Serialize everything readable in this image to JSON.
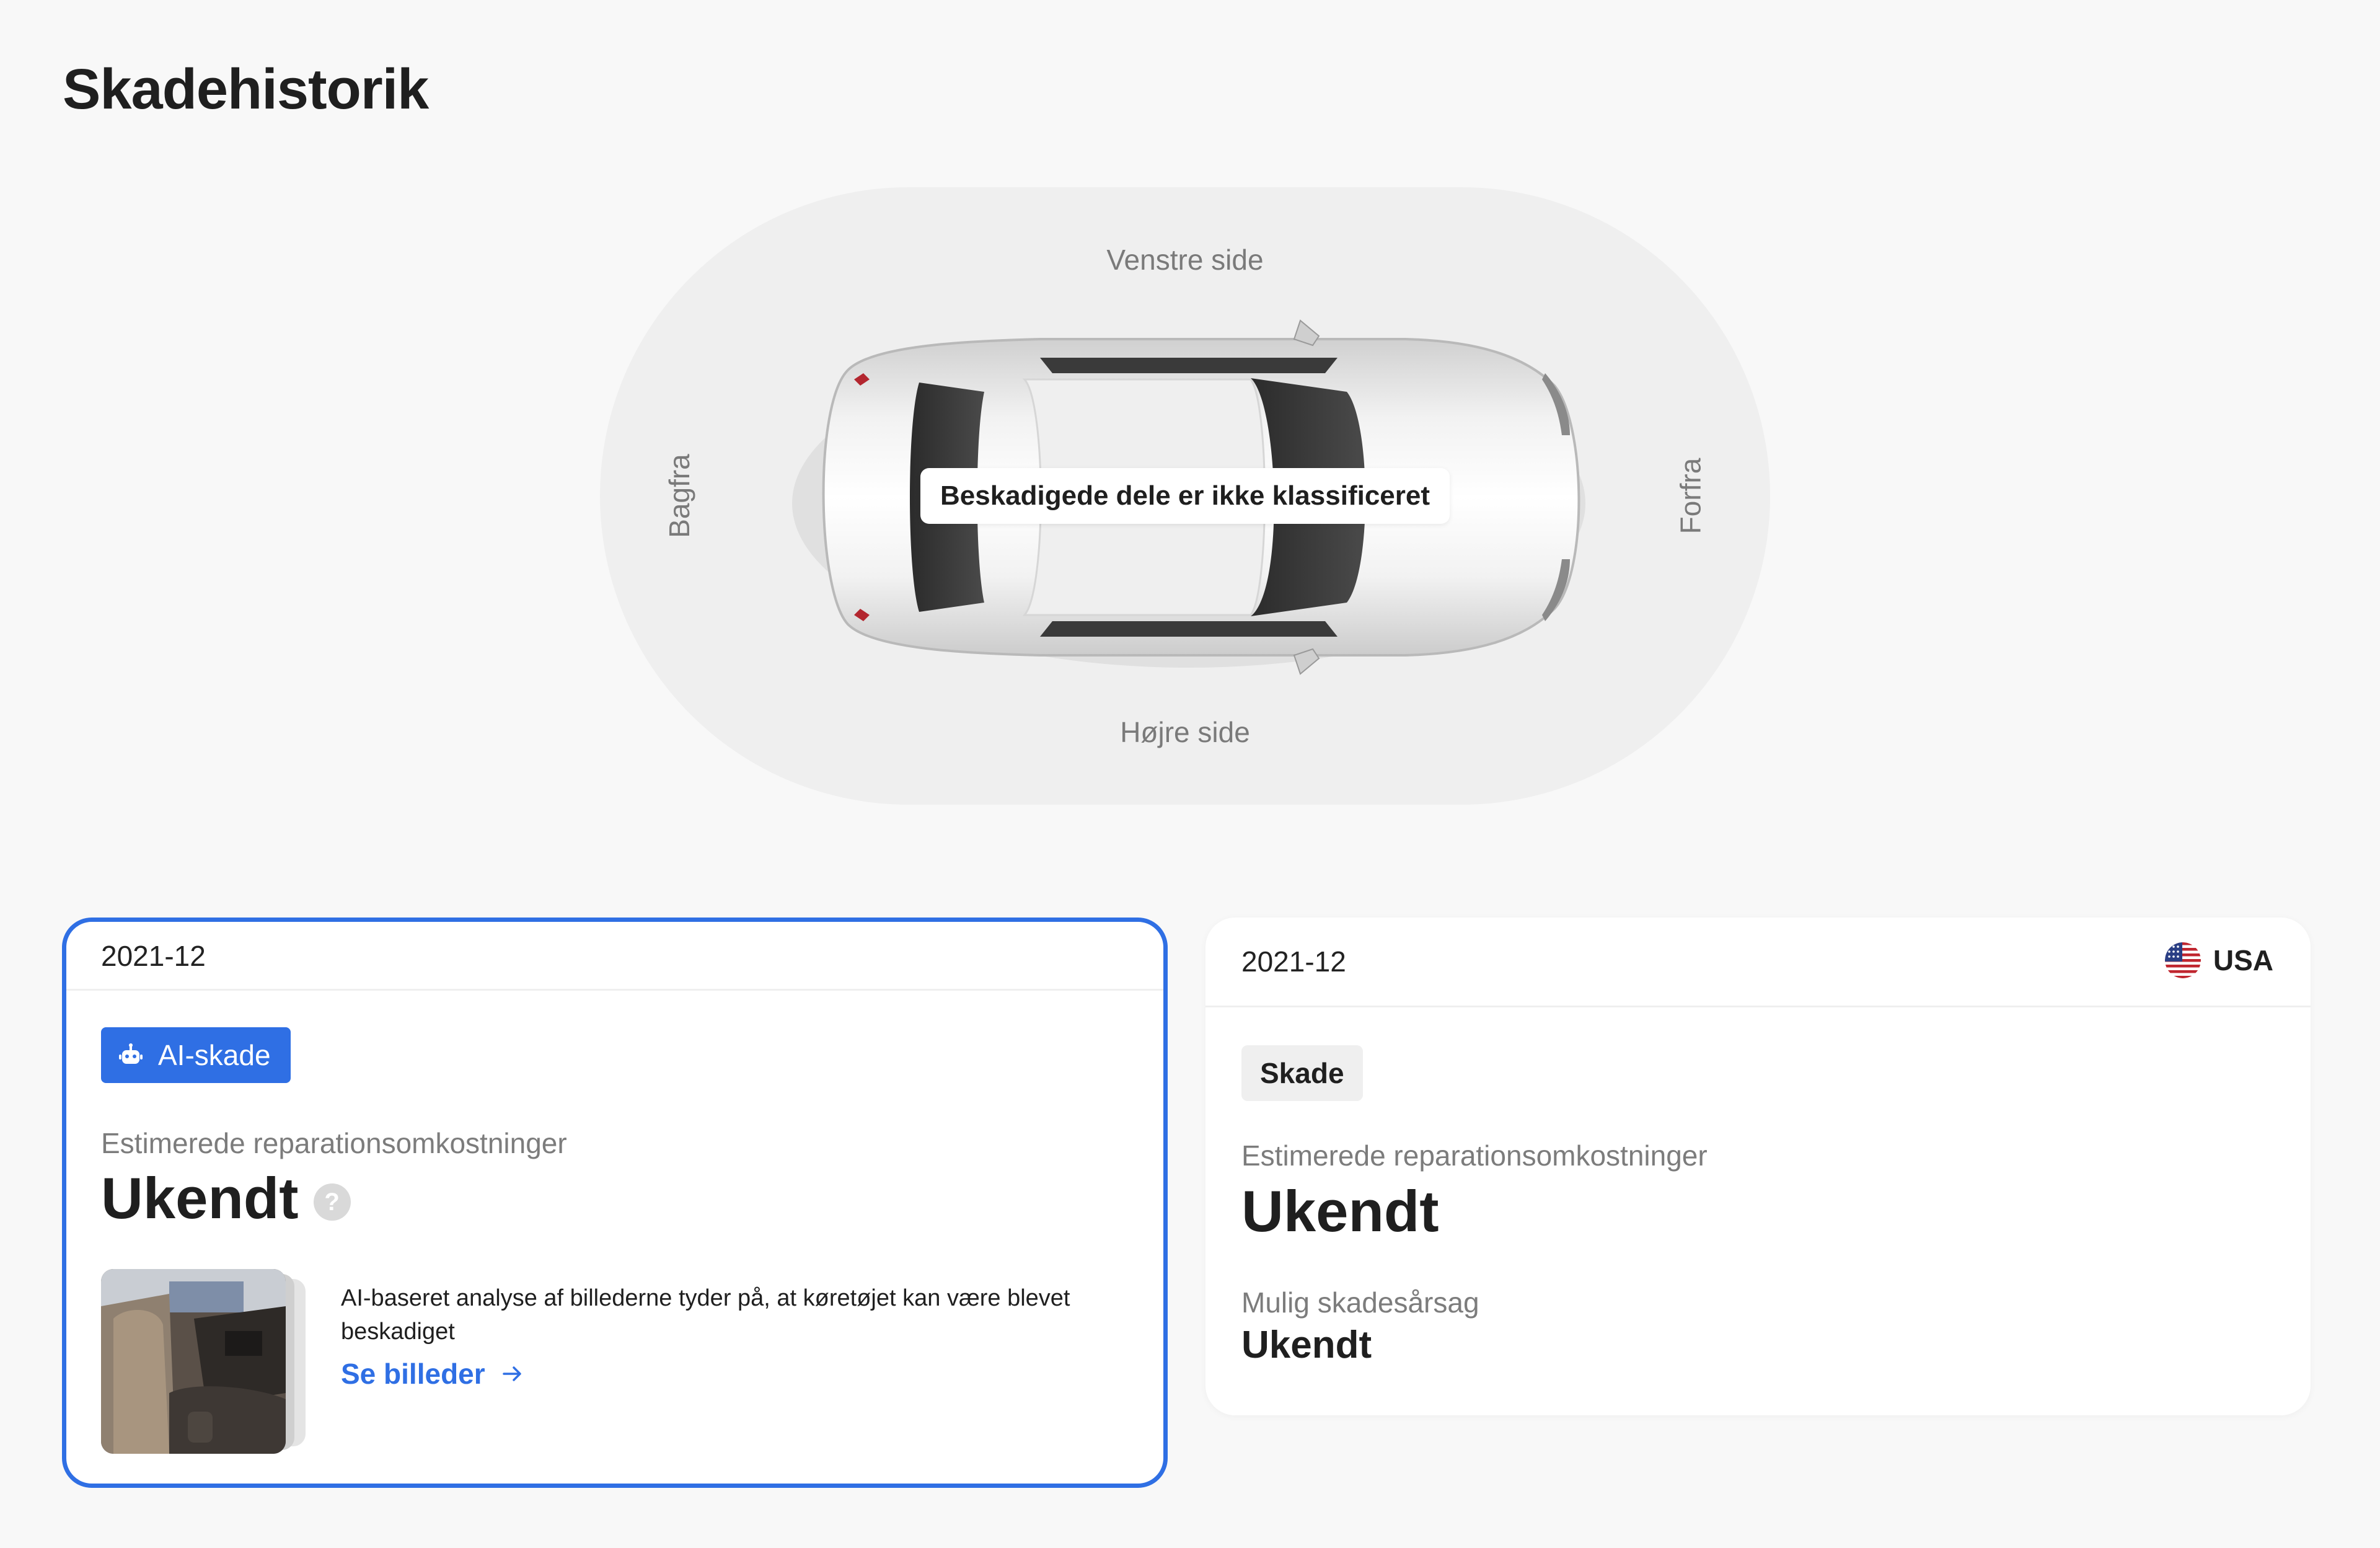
{
  "page": {
    "title": "Skadehistorik"
  },
  "diagram": {
    "label_left_side": "Venstre side",
    "label_right_side": "Højre side",
    "label_rear": "Bagfra",
    "label_front": "Forfra",
    "tooltip": "Beskadigede dele er ikke klassificeret"
  },
  "records": [
    {
      "date": "2021-12",
      "badge": {
        "label": "AI-skade",
        "icon": "robot-icon",
        "color": "#2f6fe4"
      },
      "cost_label": "Estimerede reparationsomkostninger",
      "cost_value": "Ukendt",
      "help_icon": "?",
      "analysis_text": "AI-baseret analyse af billederne tyder på, at køretøjet kan være blevet beskadiget",
      "see_photos_label": "Se billeder",
      "selected": true
    },
    {
      "date": "2021-12",
      "country": {
        "name": "USA",
        "flag_icon": "us-flag-icon"
      },
      "badge": {
        "label": "Skade"
      },
      "cost_label": "Estimerede reparationsomkostninger",
      "cost_value": "Ukendt",
      "cause_label": "Mulig skadesårsag",
      "cause_value": "Ukendt"
    }
  ],
  "colors": {
    "accent": "#2f6fe4",
    "background": "#f8f8f8",
    "card": "#ffffff"
  }
}
